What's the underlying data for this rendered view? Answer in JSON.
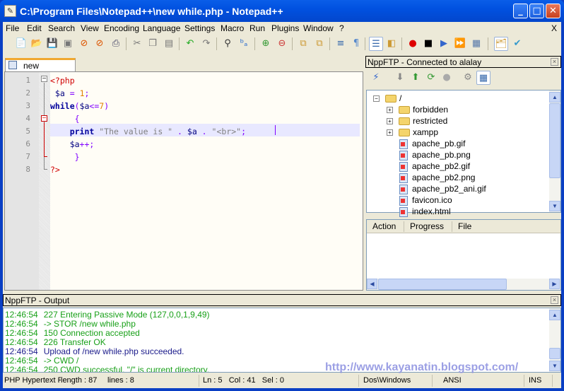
{
  "window": {
    "title": "C:\\Program Files\\Notepad++\\new while.php - Notepad++",
    "minimize": "_",
    "maximize": "□",
    "close": "✕"
  },
  "menu": [
    "File",
    "Edit",
    "Search",
    "View",
    "Encoding",
    "Language",
    "Settings",
    "Macro",
    "Run",
    "Plugins",
    "Window",
    "?"
  ],
  "menu_close": "X",
  "toolbar": [
    {
      "name": "new-file",
      "g": "📄",
      "c": "#3a3"
    },
    {
      "name": "open-file",
      "g": "📂",
      "c": "#d90"
    },
    {
      "name": "save",
      "g": "💾",
      "c": "#777"
    },
    {
      "name": "save-all",
      "g": "▣",
      "c": "#777"
    },
    {
      "name": "close",
      "g": "⊘",
      "c": "#d50"
    },
    {
      "name": "close-all",
      "g": "⊘",
      "c": "#d50"
    },
    {
      "name": "print",
      "g": "⎙",
      "c": "#446"
    },
    {
      "name": "cut",
      "g": "✂",
      "c": "#777"
    },
    {
      "name": "copy",
      "g": "❐",
      "c": "#777"
    },
    {
      "name": "paste",
      "g": "▤",
      "c": "#777"
    },
    {
      "name": "undo",
      "g": "↶",
      "c": "#2a2"
    },
    {
      "name": "redo",
      "g": "↷",
      "c": "#777"
    },
    {
      "name": "find",
      "g": "⚲",
      "c": "#333"
    },
    {
      "name": "replace",
      "g": "ᵇₐ",
      "c": "#26c"
    },
    {
      "name": "zoom-in",
      "g": "⊕",
      "c": "#393"
    },
    {
      "name": "zoom-out",
      "g": "⊖",
      "c": "#c33"
    },
    {
      "name": "sync-vertical",
      "g": "⧉",
      "c": "#c93"
    },
    {
      "name": "sync-horizontal",
      "g": "⧉",
      "c": "#c93"
    },
    {
      "name": "word-wrap",
      "g": "≡",
      "c": "#36a"
    },
    {
      "name": "show-all-chars",
      "g": "¶",
      "c": "#58c"
    },
    {
      "name": "indent-guide",
      "g": "☰",
      "c": "#36a"
    },
    {
      "name": "user-lang",
      "g": "◧",
      "c": "#c93"
    },
    {
      "name": "record-macro",
      "g": "●",
      "c": "#d00"
    },
    {
      "name": "stop-record",
      "g": "■",
      "c": "#000"
    },
    {
      "name": "play-macro",
      "g": "▶",
      "c": "#36c"
    },
    {
      "name": "run-macro-multiple",
      "g": "⏩",
      "c": "#36c"
    },
    {
      "name": "save-macro",
      "g": "▦",
      "c": "#57a"
    },
    {
      "name": "nppftp-show",
      "g": "🗂",
      "c": "#c93"
    },
    {
      "name": "spell-check",
      "g": "✔",
      "c": "#39c"
    }
  ],
  "tab": {
    "label": "new while.php"
  },
  "editor": {
    "line_numbers": [
      "1",
      "2",
      "3",
      "4",
      "5",
      "6",
      "7",
      "8"
    ],
    "lines": [
      [
        {
          "t": "<?php",
          "c": "tag"
        }
      ],
      [
        {
          "t": " $a",
          "c": "var"
        },
        {
          "t": " = ",
          "c": "op"
        },
        {
          "t": "1",
          "c": "num"
        },
        {
          "t": ";",
          "c": "op"
        }
      ],
      [
        {
          "t": "while",
          "c": "kw"
        },
        {
          "t": "(",
          "c": "op"
        },
        {
          "t": "$a",
          "c": "var"
        },
        {
          "t": "<=",
          "c": "op"
        },
        {
          "t": "7",
          "c": "num"
        },
        {
          "t": ")",
          "c": "op"
        }
      ],
      [
        {
          "t": "     {",
          "c": "op"
        }
      ],
      [
        {
          "t": "    ",
          "c": ""
        },
        {
          "t": "print",
          "c": "kw"
        },
        {
          "t": " \"The value is \" ",
          "c": "str"
        },
        {
          "t": ". ",
          "c": "op"
        },
        {
          "t": "$a",
          "c": "var"
        },
        {
          "t": " . ",
          "c": "op"
        },
        {
          "t": "\"<br>\"",
          "c": "str"
        },
        {
          "t": ";",
          "c": "op"
        }
      ],
      [
        {
          "t": "    $a",
          "c": "var"
        },
        {
          "t": "++;",
          "c": "op"
        }
      ],
      [
        {
          "t": "     }",
          "c": "op"
        }
      ],
      [
        {
          "t": "?>",
          "c": "tag"
        }
      ]
    ]
  },
  "ftp": {
    "title": "NppFTP - Connected to alalay",
    "toolbar": [
      "connect",
      "download",
      "upload",
      "refresh",
      "abort",
      "settings",
      "message-window"
    ],
    "tree": [
      {
        "label": "/",
        "type": "folder",
        "level": 0,
        "toggle": "−"
      },
      {
        "label": "forbidden",
        "type": "folder",
        "level": 1,
        "toggle": "+"
      },
      {
        "label": "restricted",
        "type": "folder",
        "level": 1,
        "toggle": "+"
      },
      {
        "label": "xampp",
        "type": "folder",
        "level": 1,
        "toggle": "+"
      },
      {
        "label": "apache_pb.gif",
        "type": "file",
        "level": 1
      },
      {
        "label": "apache_pb.png",
        "type": "file",
        "level": 1
      },
      {
        "label": "apache_pb2.gif",
        "type": "file",
        "level": 1
      },
      {
        "label": "apache_pb2.png",
        "type": "file",
        "level": 1
      },
      {
        "label": "apache_pb2_ani.gif",
        "type": "file",
        "level": 1
      },
      {
        "label": "favicon.ico",
        "type": "file",
        "level": 1
      },
      {
        "label": "index.html",
        "type": "file",
        "level": 1
      }
    ],
    "queue_columns": [
      "Action",
      "Progress",
      "File"
    ]
  },
  "output": {
    "title": "NppFTP - Output",
    "lines": [
      {
        "time": "12:46:54",
        "msg": "227 Entering Passive Mode (127,0,0,1,9,49)",
        "kind": "green"
      },
      {
        "time": "12:46:54",
        "msg": "-> STOR /new while.php",
        "kind": "green"
      },
      {
        "time": "12:46:54",
        "msg": "150 Connection accepted",
        "kind": "green"
      },
      {
        "time": "12:46:54",
        "msg": "226 Transfer OK",
        "kind": "green"
      },
      {
        "time": "12:46:54",
        "msg": "Upload of /new while.php succeeded.",
        "kind": "blue"
      },
      {
        "time": "12:46:54",
        "msg": "-> CWD /",
        "kind": "green"
      },
      {
        "time": "12:46:54",
        "msg": "250 CWD successful. \"/\" is current directory.",
        "kind": "green"
      }
    ]
  },
  "watermark": "http://www.kayanatin.blogspot.com/",
  "status": {
    "lang": "PHP Hypertext Preprocessor file",
    "length": "length : 87",
    "lines": "lines : 8",
    "ln": "Ln : 5",
    "col": "Col : 41",
    "sel": "Sel : 0",
    "eol": "Dos\\Windows",
    "encoding": "ANSI",
    "mode": "INS"
  }
}
